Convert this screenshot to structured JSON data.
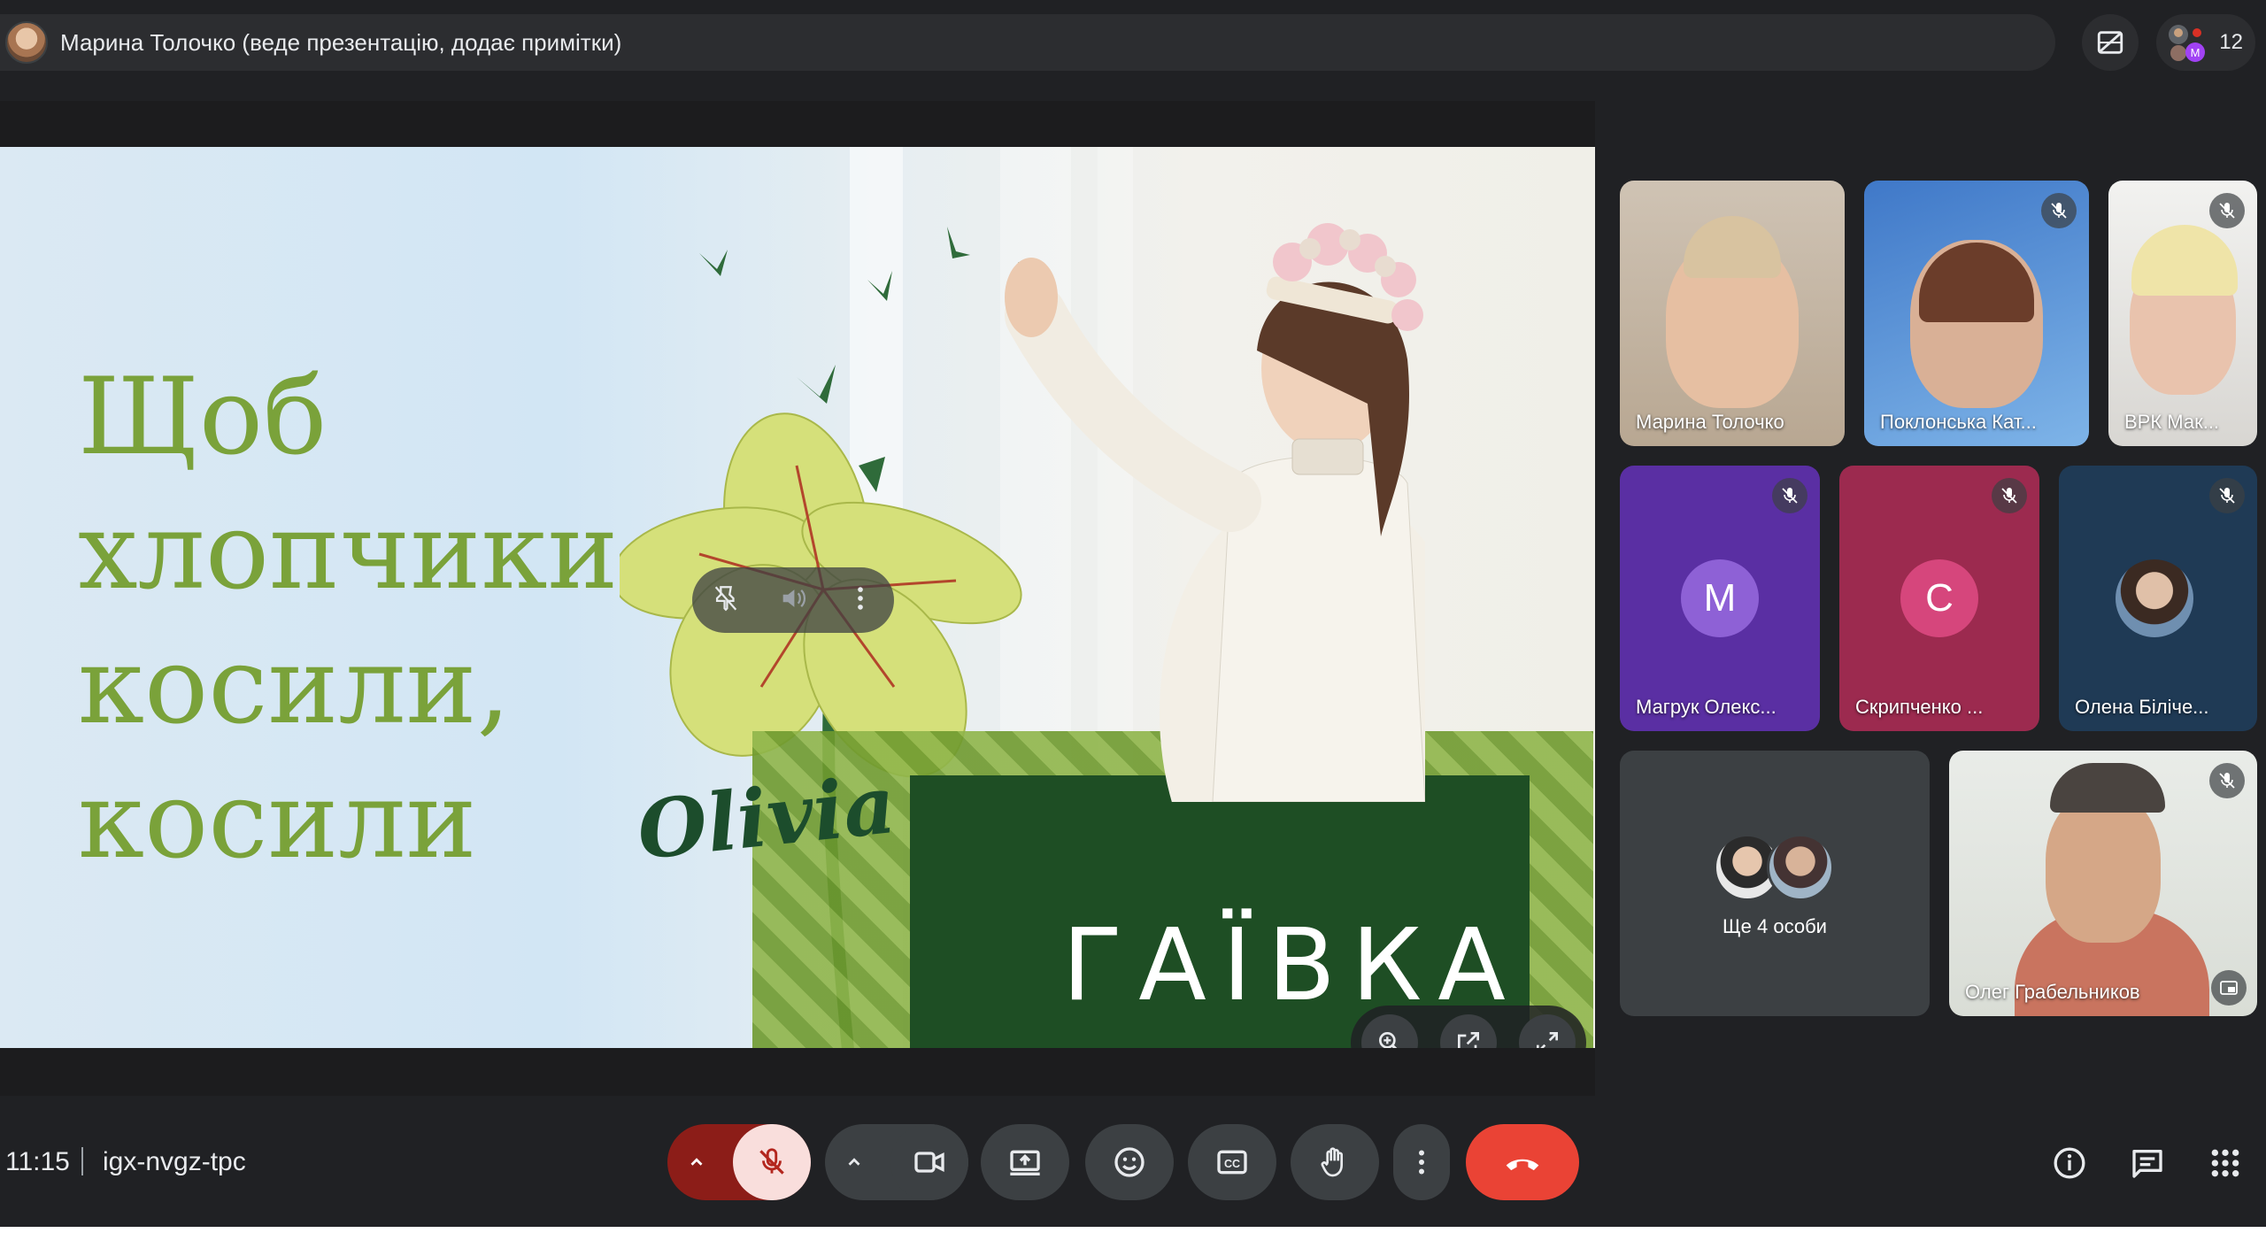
{
  "presenter_bar": {
    "text": "Марина Толочко (веде презентацію, додає примітки)"
  },
  "participants_count": "12",
  "slide": {
    "lines": [
      "Щоб",
      "хлопчики",
      "косили,",
      "косили"
    ],
    "script_word": "Olivia",
    "title": "ГАЇВКА"
  },
  "tiles": [
    {
      "name": "Марина Толочко",
      "muted": false
    },
    {
      "name": "Поклонська Кат...",
      "muted": true
    },
    {
      "name": "ВРК Мак...",
      "muted": true
    },
    {
      "name": "Магрук Олекс...",
      "initial": "М",
      "color": "#7b47c8",
      "muted": true
    },
    {
      "name": "Скрипченко ...",
      "initial": "С",
      "color": "#d6467c",
      "muted": true
    },
    {
      "name": "Олена Біліче...",
      "muted": true
    },
    {
      "name": "Ще 4 особи"
    },
    {
      "name": "Олег Грабельников",
      "muted": true
    }
  ],
  "footer": {
    "time": "11:15",
    "meeting_code": "igx-nvgz-tpc"
  },
  "colors": {
    "end_call": "#ea4335",
    "mic_off_bg": "#f9dedc",
    "mic_off_icon": "#b3261e",
    "mic_chevron_bg": "#8c1d18"
  },
  "icons": [
    "hide-tiles-icon",
    "people-icon",
    "mic-off-icon",
    "camera-icon",
    "present-icon",
    "emoji-icon",
    "captions-icon",
    "raise-hand-icon",
    "more-vert-icon",
    "end-call-icon",
    "info-icon",
    "chat-icon",
    "activities-icon",
    "zoom-in-icon",
    "pop-out-icon",
    "fullscreen-icon",
    "pin-off-icon",
    "volume-icon"
  ]
}
